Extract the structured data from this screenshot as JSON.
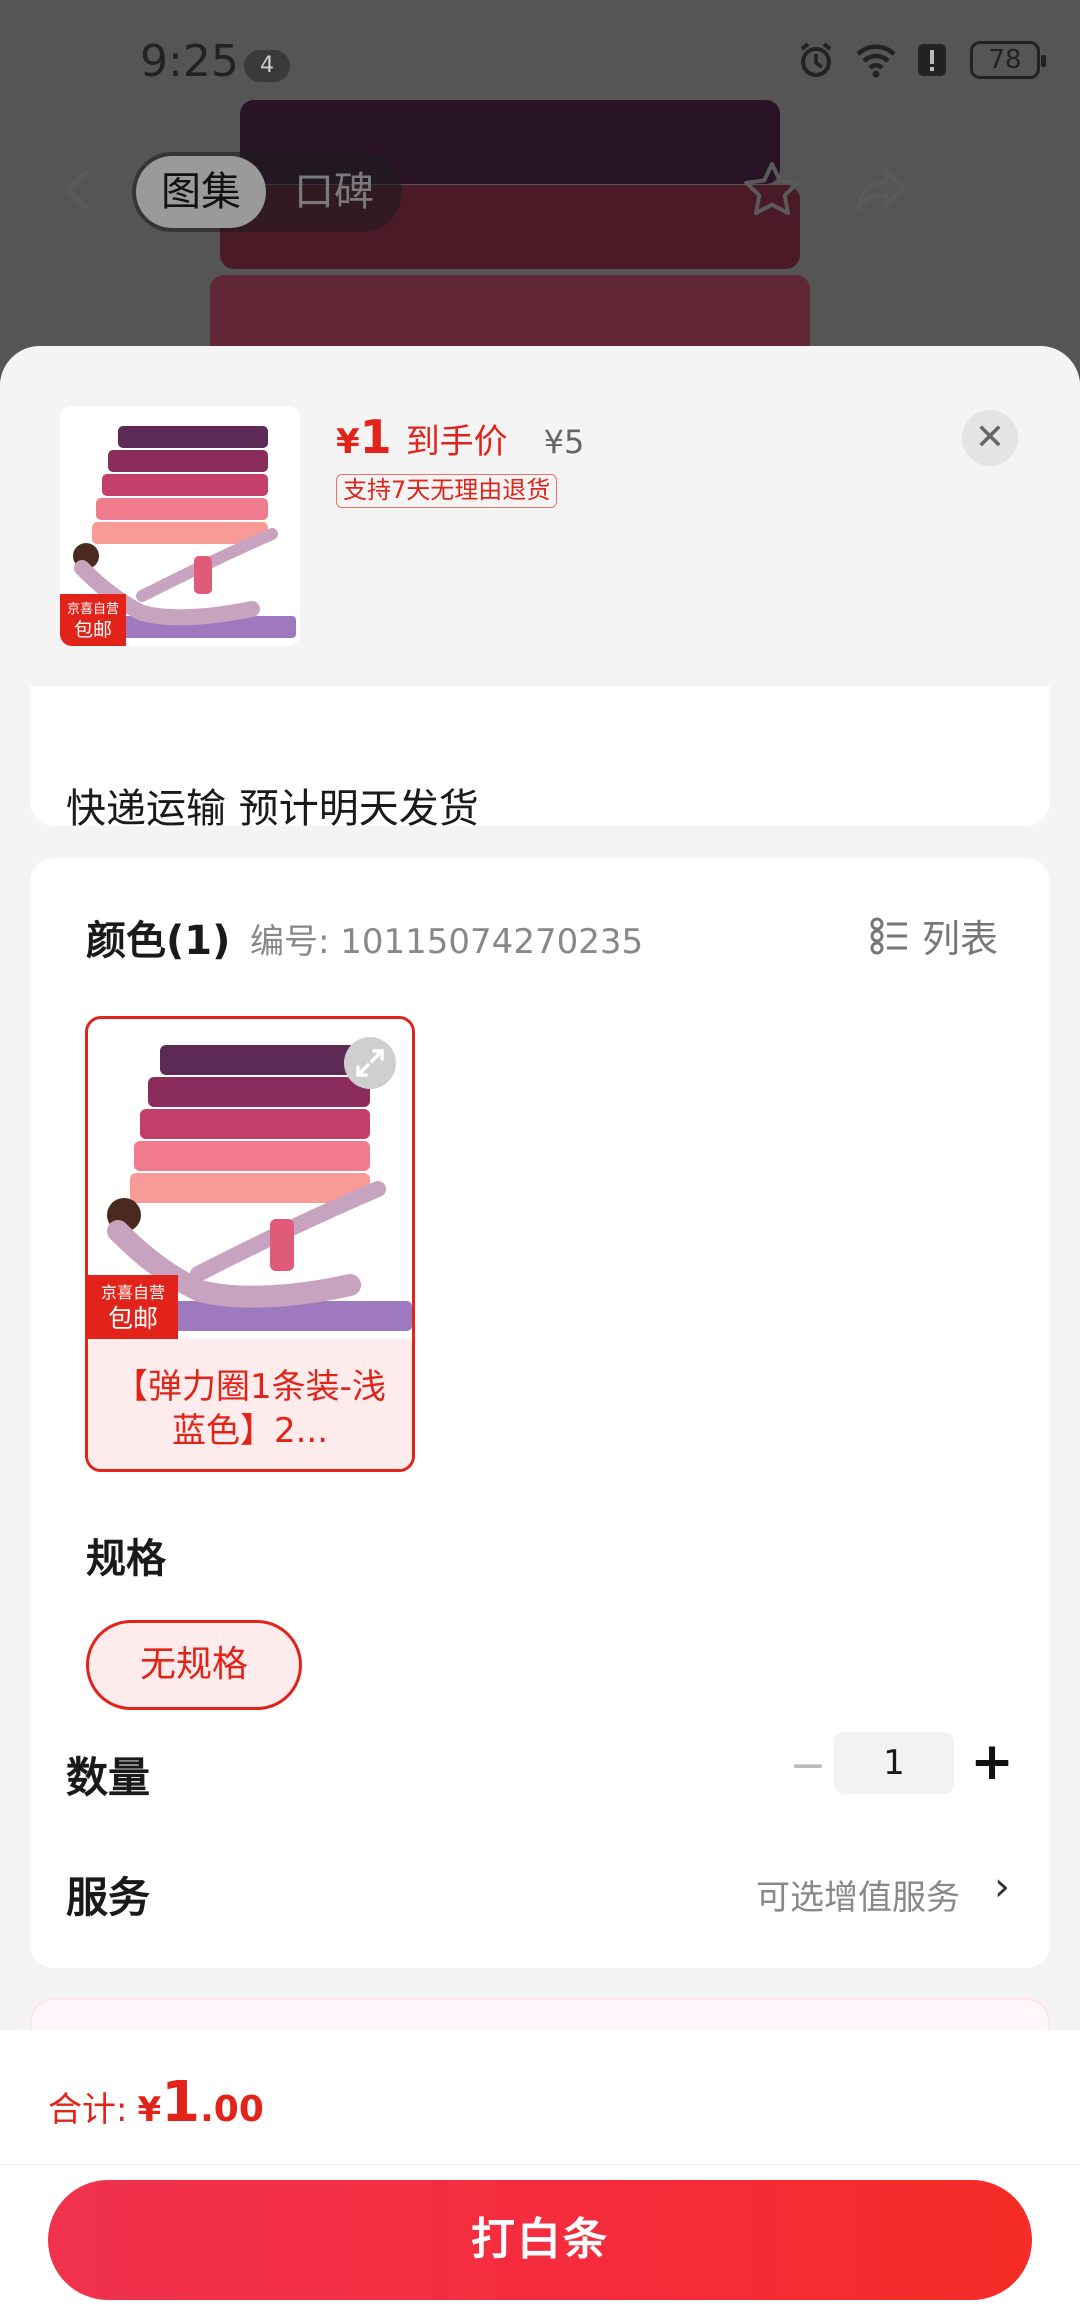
{
  "status_bar": {
    "time": "9:25",
    "notification_count": "4",
    "battery": "78"
  },
  "top_nav": {
    "tab_gallery": "图集",
    "tab_reviews": "口碑"
  },
  "sheet": {
    "price": {
      "currency": "¥",
      "amount": "1",
      "label": "到手价",
      "original": "¥5"
    },
    "return_policy": "支持7天无理由退货",
    "thumb_badge": {
      "top": "京喜自营",
      "bottom": "包邮"
    },
    "delivery_text": "快递运输 预计明天发货",
    "color_section": {
      "title": "颜色(1)",
      "code": "编号: 10115074270235",
      "list_toggle": "列表",
      "options": [
        {
          "label": "【弹力圈1条装-浅蓝色】2...",
          "badge_top": "京喜自营",
          "badge_bottom": "包邮"
        }
      ]
    },
    "spec_section": {
      "title": "规格",
      "options": [
        "无规格"
      ]
    },
    "quantity": {
      "label": "数量",
      "minus": "−",
      "value": "1",
      "plus": "+"
    },
    "service": {
      "label": "服务",
      "value": "可选增值服务"
    }
  },
  "footer": {
    "total_label": "合计:",
    "currency": "¥",
    "total_int": "1",
    "total_dec": ".00",
    "pay_button": "打白条"
  },
  "colors": {
    "accent": "#e2231a",
    "button_start": "#f0324d",
    "button_end": "#f52c27"
  },
  "icons": [
    "back-icon",
    "star-icon",
    "share-icon",
    "more-icon",
    "close-icon",
    "list-icon",
    "expand-icon",
    "chevron-right-icon",
    "alarm-icon",
    "wifi-icon",
    "alert-icon",
    "battery-icon"
  ]
}
